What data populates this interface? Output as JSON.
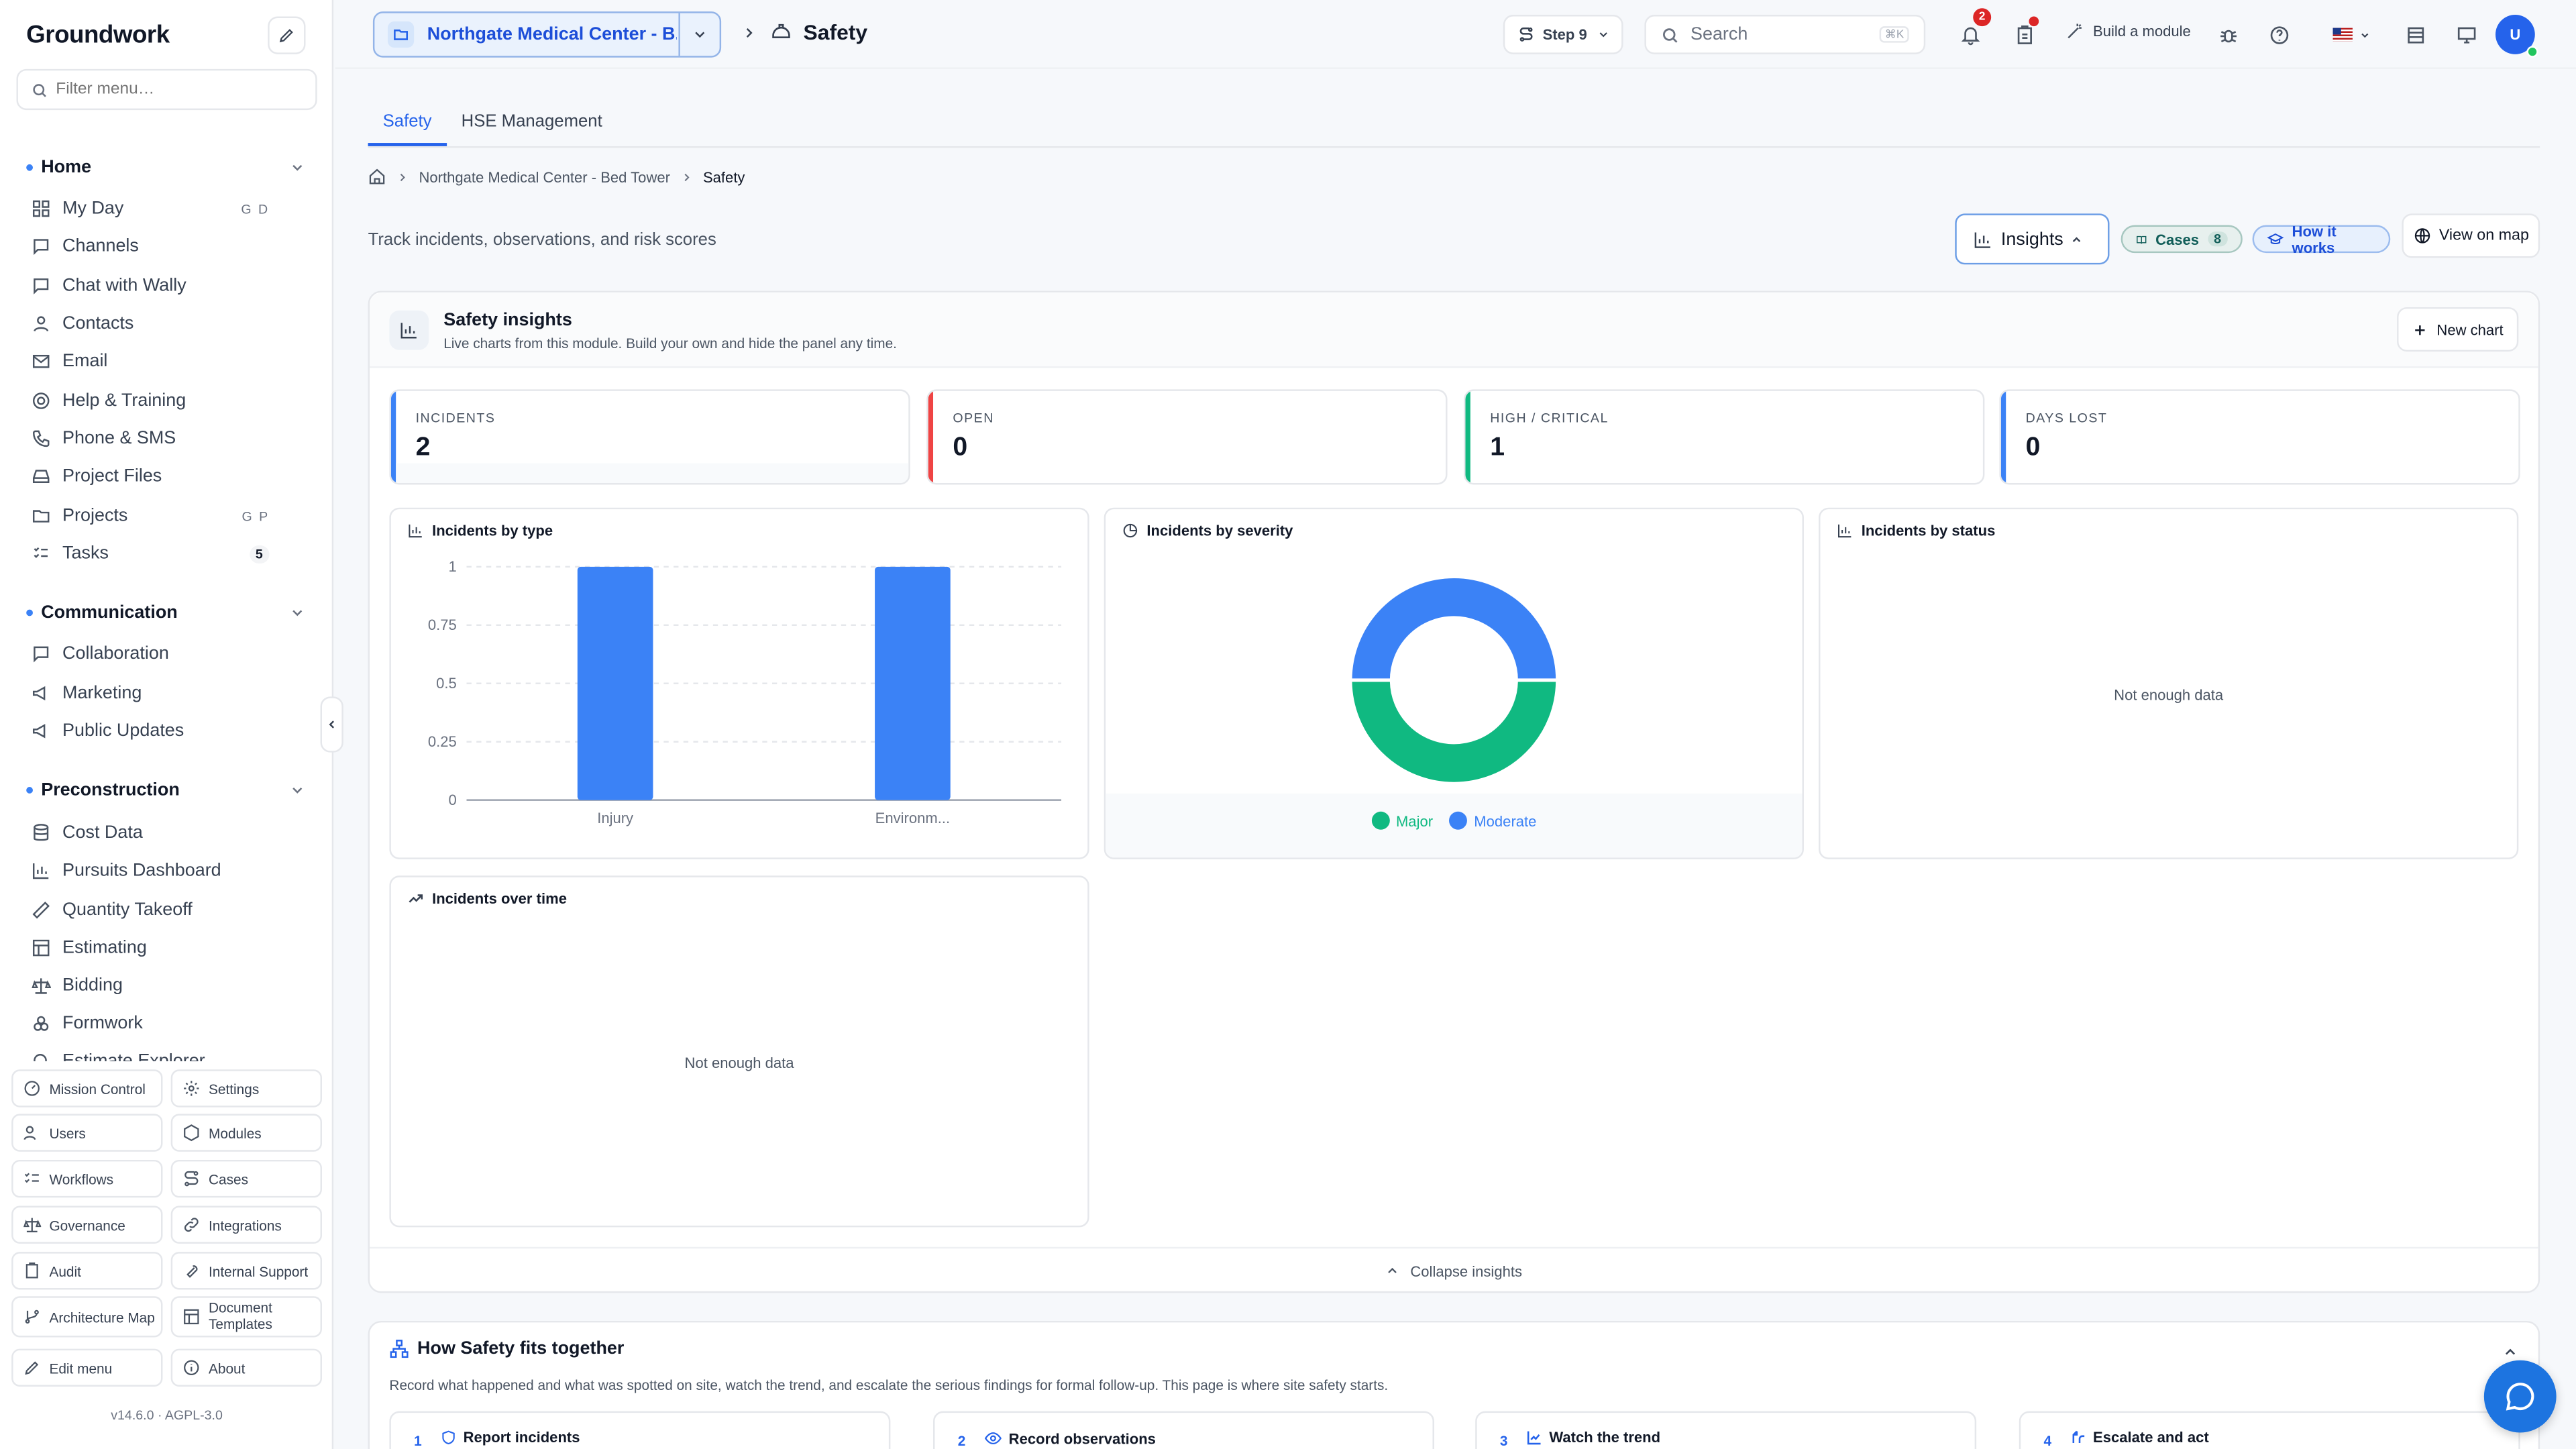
{
  "app": {
    "brand": "Groundwork",
    "version": "v14.6.0",
    "license": "AGPL-3.0"
  },
  "sidebar": {
    "filter_placeholder": "Filter menu…",
    "sections": {
      "home": {
        "label": "Home",
        "items": [
          {
            "label": "My Day",
            "shortcut": "G D",
            "icon": "grid-icon"
          },
          {
            "label": "Channels",
            "icon": "chat-bubble-icon"
          },
          {
            "label": "Chat with Wally",
            "icon": "chat-bubble-icon"
          },
          {
            "label": "Contacts",
            "icon": "user-icon"
          },
          {
            "label": "Email",
            "icon": "mail-icon"
          },
          {
            "label": "Help & Training",
            "icon": "lifebuoy-icon"
          },
          {
            "label": "Phone & SMS",
            "icon": "phone-icon"
          },
          {
            "label": "Project Files",
            "icon": "drive-icon"
          },
          {
            "label": "Projects",
            "shortcut": "G P",
            "icon": "folder-icon"
          },
          {
            "label": "Tasks",
            "count": "5",
            "icon": "checklist-icon"
          }
        ]
      },
      "communication": {
        "label": "Communication",
        "items": [
          {
            "label": "Collaboration",
            "icon": "chat-bubble-icon"
          },
          {
            "label": "Marketing",
            "icon": "megaphone-icon"
          },
          {
            "label": "Public Updates",
            "icon": "megaphone-icon"
          }
        ]
      },
      "preconstruction": {
        "label": "Preconstruction",
        "items": [
          {
            "label": "Cost Data",
            "icon": "database-icon"
          },
          {
            "label": "Pursuits Dashboard",
            "icon": "bar-chart-icon"
          },
          {
            "label": "Quantity Takeoff",
            "icon": "ruler-icon"
          },
          {
            "label": "Estimating",
            "icon": "table-icon"
          },
          {
            "label": "Bidding",
            "icon": "scale-icon"
          },
          {
            "label": "Formwork",
            "icon": "blocks-icon"
          },
          {
            "label": "Estimate Explorer",
            "icon": "search-icon"
          }
        ]
      }
    },
    "bottom": [
      {
        "label": "Mission Control",
        "icon": "gauge-icon"
      },
      {
        "label": "Settings",
        "icon": "gear-icon"
      },
      {
        "label": "Users",
        "icon": "users-icon"
      },
      {
        "label": "Modules",
        "icon": "box-icon"
      },
      {
        "label": "Workflows",
        "icon": "list-checks-icon"
      },
      {
        "label": "Cases",
        "icon": "route-icon"
      },
      {
        "label": "Governance",
        "icon": "scale-icon"
      },
      {
        "label": "Integrations",
        "icon": "link-icon"
      },
      {
        "label": "Audit",
        "icon": "clipboard-icon"
      },
      {
        "label": "Internal Support",
        "icon": "wrench-icon"
      },
      {
        "label": "Architecture Map",
        "icon": "git-branch-icon"
      },
      {
        "label": "Document Templates",
        "icon": "template-icon"
      },
      {
        "label": "Edit menu",
        "icon": "pencil-icon"
      },
      {
        "label": "About",
        "icon": "info-icon"
      }
    ]
  },
  "topbar": {
    "project": "Northgate Medical Center - B...",
    "page_title": "Safety",
    "step_label": "Step 9",
    "search_placeholder": "Search",
    "search_shortcut": "⌘K",
    "notifications_count": "2",
    "build_module": "Build a module",
    "avatar_initial": "U"
  },
  "main": {
    "tabs": [
      "Safety",
      "HSE Management"
    ],
    "breadcrumb": [
      "Northgate Medical Center - Bed Tower",
      "Safety"
    ],
    "subtitle": "Track incidents, observations, and risk scores",
    "actions": {
      "insights": "Insights",
      "cases": "Cases",
      "cases_count": "8",
      "how": "How it works",
      "map": "View on map"
    },
    "insights": {
      "title": "Safety insights",
      "subtitle": "Live charts from this module. Build your own and hide the panel any time.",
      "new_chart": "New chart",
      "kpis": [
        {
          "label": "INCIDENTS",
          "value": "2",
          "color": "#3b82f6"
        },
        {
          "label": "OPEN",
          "value": "0",
          "color": "#ef4444"
        },
        {
          "label": "HIGH / CRITICAL",
          "value": "1",
          "color": "#10b981"
        },
        {
          "label": "DAYS LOST",
          "value": "0",
          "color": "#3b82f6"
        }
      ],
      "cards": {
        "by_type": "Incidents by type",
        "by_severity": "Incidents by severity",
        "by_status": "Incidents by status",
        "over_time": "Incidents over time"
      },
      "not_enough": "Not enough data",
      "collapse": "Collapse insights"
    },
    "fits": {
      "title": "How Safety fits together",
      "desc": "Record what happened and what was spotted on site, watch the trend, and escalate the serious findings for formal follow-up. This page is where site safety starts.",
      "steps": [
        {
          "n": "1",
          "label": "Report incidents"
        },
        {
          "n": "2",
          "label": "Record observations"
        },
        {
          "n": "3",
          "label": "Watch the trend"
        },
        {
          "n": "4",
          "label": "Escalate and act"
        }
      ]
    }
  },
  "chart_data": [
    {
      "type": "bar",
      "title": "Incidents by type",
      "categories": [
        "Injury",
        "Environm..."
      ],
      "values": [
        1,
        1
      ],
      "ylim": [
        0,
        1
      ],
      "yticks": [
        "0",
        "0.25",
        "0.5",
        "0.75",
        "1"
      ],
      "grid": true,
      "color": "#3b82f6"
    },
    {
      "type": "pie",
      "title": "Incidents by severity",
      "labels": [
        "Major",
        "Moderate"
      ],
      "values": [
        1,
        1
      ],
      "colors": [
        "#10b981",
        "#3b82f6"
      ],
      "legend": "bottom"
    }
  ]
}
